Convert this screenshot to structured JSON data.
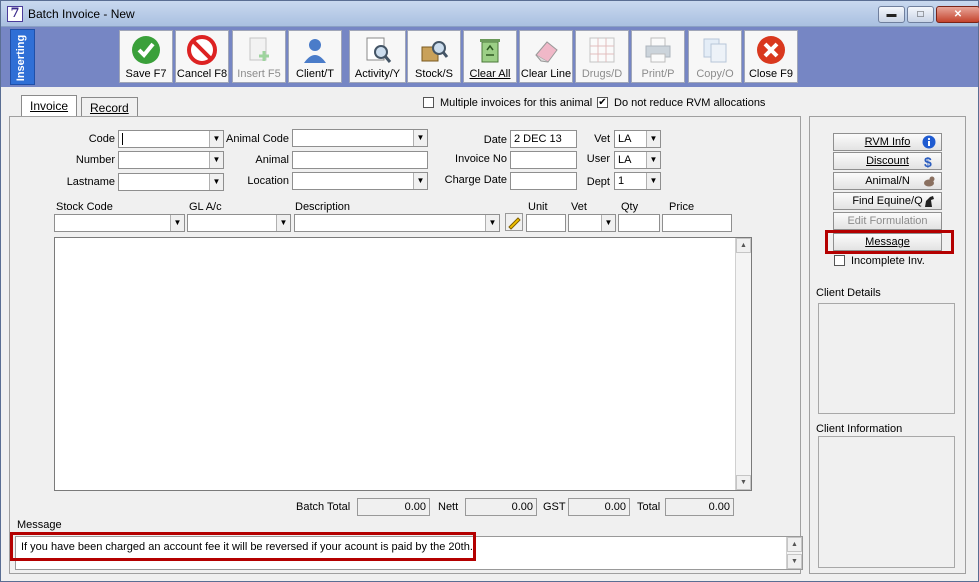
{
  "window": {
    "app_icon": "7",
    "title": "Batch Invoice - New"
  },
  "window_controls": {
    "minimize": "▬",
    "maximize": "□",
    "close": "✕"
  },
  "toolbar": {
    "mode": "Inserting",
    "buttons": [
      {
        "label": "Save F7",
        "icon": "check-icon"
      },
      {
        "label": "Cancel F8",
        "icon": "no-entry-icon"
      },
      {
        "label": "Insert F5",
        "icon": "insert-page-icon"
      },
      {
        "label": "Client/T",
        "icon": "person-icon"
      },
      {
        "label": "Activity/Y",
        "icon": "magnifier-document-icon"
      },
      {
        "label": "Stock/S",
        "icon": "stock-box-icon"
      },
      {
        "label": "Clear All",
        "icon": "recycle-bin-icon"
      },
      {
        "label": "Clear Line",
        "icon": "eraser-icon"
      },
      {
        "label": "Drugs/D",
        "icon": "drugs-grid-icon"
      },
      {
        "label": "Print/P",
        "icon": "printer-icon"
      },
      {
        "label": "Copy/O",
        "icon": "copy-icon"
      },
      {
        "label": "Close F9",
        "icon": "close-circle-icon"
      }
    ]
  },
  "tabs": [
    {
      "label": "Invoice"
    },
    {
      "label": "Record"
    }
  ],
  "options": {
    "multiple_invoices": {
      "label": "Multiple invoices for this animal",
      "checked": false
    },
    "no_reduce_rvm": {
      "label": "Do not reduce RVM allocations",
      "checked": true,
      "mark": "✔"
    }
  },
  "form": {
    "code": {
      "label": "Code",
      "value": ""
    },
    "number": {
      "label": "Number",
      "value": ""
    },
    "lastname": {
      "label": "Lastname",
      "value": ""
    },
    "animal_code": {
      "label": "Animal Code",
      "value": ""
    },
    "animal": {
      "label": "Animal",
      "value": ""
    },
    "location": {
      "label": "Location",
      "value": ""
    },
    "date": {
      "label": "Date",
      "value": "2 DEC 13"
    },
    "invoice_no": {
      "label": "Invoice No",
      "value": ""
    },
    "charge_date": {
      "label": "Charge Date",
      "value": ""
    },
    "vet": {
      "label": "Vet",
      "value": "LA"
    },
    "user": {
      "label": "User",
      "value": "LA"
    },
    "dept": {
      "label": "Dept",
      "value": "1"
    }
  },
  "line_entry": {
    "stock_code": "Stock Code",
    "gl": "GL A/c",
    "description": "Description",
    "unit": "Unit",
    "vet": "Vet",
    "qty": "Qty",
    "price": "Price"
  },
  "totals": {
    "batch_total": {
      "label": "Batch Total",
      "value": "0.00"
    },
    "nett": {
      "label": "Nett",
      "value": "0.00"
    },
    "gst": {
      "label": "GST",
      "value": "0.00"
    },
    "total": {
      "label": "Total",
      "value": "0.00"
    }
  },
  "message": {
    "label": "Message",
    "text": "If you have been charged an account fee it will be reversed if your acount is paid by the 20th."
  },
  "side": {
    "buttons": [
      {
        "label": "RVM Info",
        "icon": "info-icon"
      },
      {
        "label": "Discount",
        "icon": "dollar-icon"
      },
      {
        "label": "Animal/N",
        "icon": "dog-icon"
      },
      {
        "label": "Find Equine/Q",
        "icon": "horse-icon"
      },
      {
        "label": "Edit Formulation",
        "icon": ""
      },
      {
        "label": "Message",
        "icon": ""
      }
    ],
    "incomplete_inv": {
      "label": "Incomplete Inv.",
      "checked": false
    },
    "client_details": "Client Details",
    "client_information": "Client Information"
  },
  "colors": {
    "highlight": "#b40000",
    "toolbar": "#7686c4",
    "mode_tab": "#2f6fd6"
  }
}
